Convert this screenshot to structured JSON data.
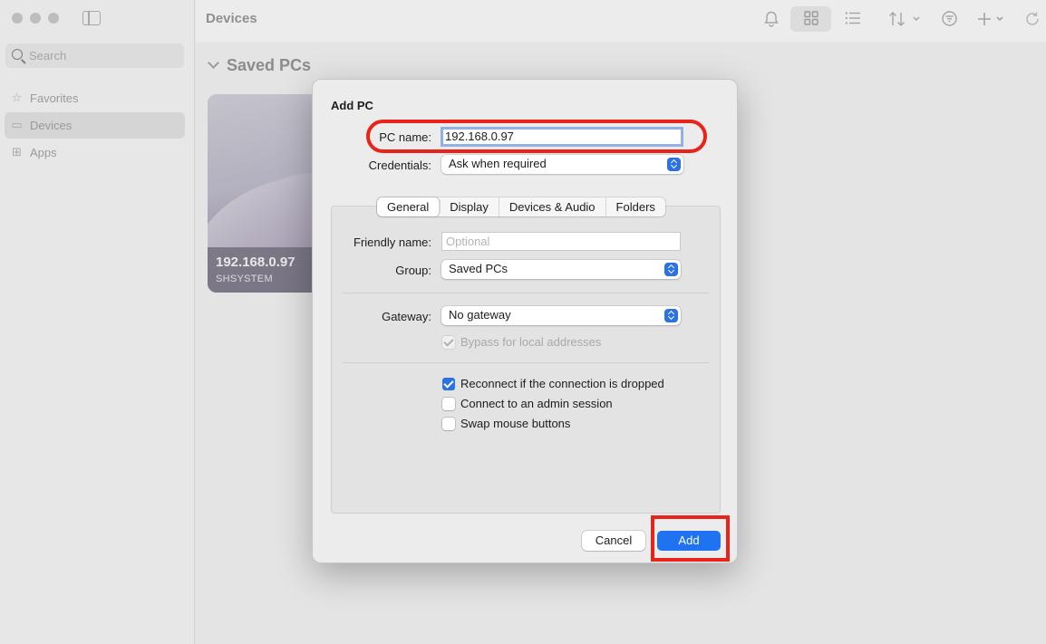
{
  "sidebar": {
    "search_placeholder": "Search",
    "items": [
      {
        "label": "Favorites",
        "icon": "star-icon"
      },
      {
        "label": "Devices",
        "icon": "display-icon",
        "active": true
      },
      {
        "label": "Apps",
        "icon": "apps-grid-icon"
      }
    ]
  },
  "toolbar": {
    "title": "Devices",
    "icons": [
      "bell-icon",
      "grid-view-icon",
      "list-view-icon",
      "sort-icon",
      "filter-icon",
      "add-icon",
      "refresh-icon"
    ]
  },
  "main": {
    "section_title": "Saved PCs",
    "card": {
      "ip": "192.168.0.97",
      "user": "SHSYSTEM"
    }
  },
  "dialog": {
    "title": "Add PC",
    "pc_name_label": "PC name:",
    "pc_name_value": "192.168.0.97",
    "credentials_label": "Credentials:",
    "credentials_value": "Ask when required",
    "tabs": [
      "General",
      "Display",
      "Devices & Audio",
      "Folders"
    ],
    "active_tab": "General",
    "friendly_name_label": "Friendly name:",
    "friendly_name_placeholder": "Optional",
    "group_label": "Group:",
    "group_value": "Saved PCs",
    "gateway_label": "Gateway:",
    "gateway_value": "No gateway",
    "bypass_label": "Bypass for local addresses",
    "options": [
      {
        "label": "Reconnect if the connection is dropped",
        "checked": true
      },
      {
        "label": "Connect to an admin session",
        "checked": false
      },
      {
        "label": "Swap mouse buttons",
        "checked": false
      }
    ],
    "cancel_label": "Cancel",
    "add_label": "Add"
  },
  "colors": {
    "accent": "#1f73f0",
    "highlight": "#e8231a"
  }
}
